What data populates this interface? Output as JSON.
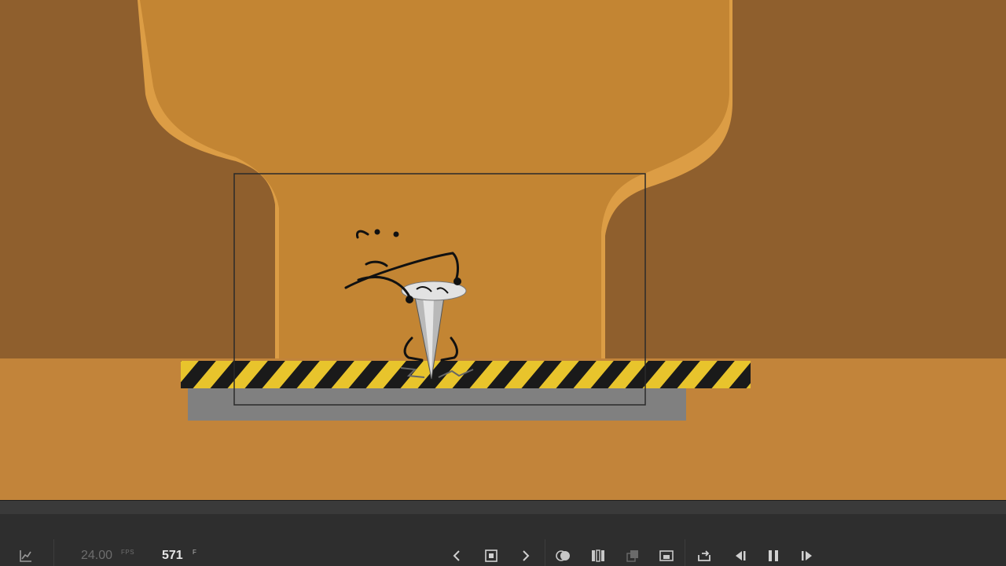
{
  "stage": {
    "colors": {
      "cave_dark": "#8f5f2d",
      "cave_mid": "#c38533",
      "cave_light": "#dc9d45",
      "ground": "#c2843a",
      "hazard_yellow": "#e8c42c",
      "hazard_black": "#1a1a1a",
      "slab_gray": "#808080"
    },
    "character": "drill-character"
  },
  "timeline": {
    "fps_value": "24.00",
    "fps_unit": "FPS",
    "frame_value": "571",
    "frame_unit": "F",
    "controls": [
      "graph-icon",
      "prev-keyframe-icon",
      "add-keyframe-icon",
      "next-keyframe-icon",
      "onion-skin-icon",
      "onion-outlines-icon",
      "edit-multiple-frames-icon",
      "frame-range-icon",
      "loop-icon",
      "step-back-icon",
      "pause-icon",
      "step-forward-icon"
    ]
  }
}
